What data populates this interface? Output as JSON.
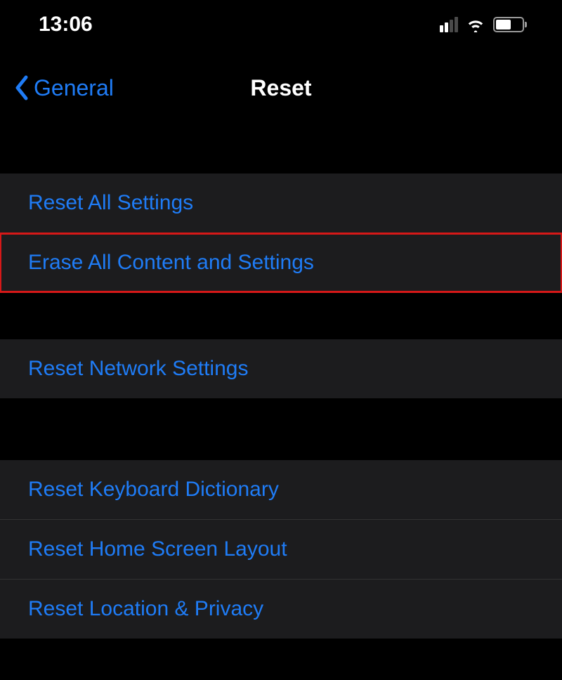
{
  "statusBar": {
    "time": "13:06"
  },
  "nav": {
    "backLabel": "General",
    "title": "Reset"
  },
  "groups": {
    "g1": {
      "items": [
        {
          "label": "Reset All Settings"
        },
        {
          "label": "Erase All Content and Settings"
        }
      ]
    },
    "g2": {
      "items": [
        {
          "label": "Reset Network Settings"
        }
      ]
    },
    "g3": {
      "items": [
        {
          "label": "Reset Keyboard Dictionary"
        },
        {
          "label": "Reset Home Screen Layout"
        },
        {
          "label": "Reset Location & Privacy"
        }
      ]
    }
  }
}
